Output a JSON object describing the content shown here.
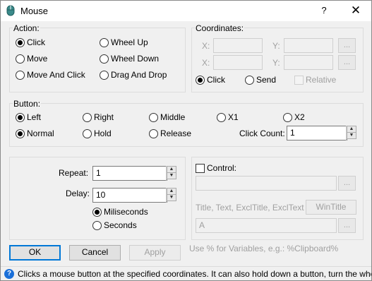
{
  "window": {
    "title": "Mouse",
    "help_label": "?",
    "close_label": "✕"
  },
  "action": {
    "legend": "Action:",
    "options": [
      "Click",
      "Wheel Up",
      "Move",
      "Wheel Down",
      "Move And Click",
      "Drag And Drop"
    ],
    "selected": "Click"
  },
  "coordinates": {
    "legend": "Coordinates:",
    "x_label": "X:",
    "y_label": "Y:",
    "x1": "",
    "y1": "",
    "x2": "",
    "y2": "",
    "browse_label": "...",
    "click_label": "Click",
    "send_label": "Send",
    "relative_label": "Relative",
    "selected": "Click"
  },
  "button": {
    "legend": "Button:",
    "options": [
      "Left",
      "Right",
      "Middle",
      "X1",
      "X2"
    ],
    "modes": [
      "Normal",
      "Hold",
      "Release"
    ],
    "selected_button": "Left",
    "selected_mode": "Normal",
    "click_count_label": "Click Count:",
    "click_count": "1"
  },
  "timing": {
    "repeat_label": "Repeat:",
    "repeat": "1",
    "delay_label": "Delay:",
    "delay": "10",
    "ms_label": "Miliseconds",
    "sec_label": "Seconds",
    "selected_unit": "Miliseconds"
  },
  "control": {
    "label": "Control:",
    "value": "",
    "browse_label": "...",
    "fields_label": "Title, Text, ExclTitle, ExclText",
    "wintitle_label": "WinTitle",
    "title_value": "A",
    "hint": "Use % for Variables, e.g.: %Clipboard%"
  },
  "footer": {
    "ok": "OK",
    "cancel": "Cancel",
    "apply": "Apply"
  },
  "status": {
    "icon": "info-icon",
    "text": "Clicks a mouse button at the specified coordinates. It can also hold down a button, turn the wheel, or move"
  }
}
